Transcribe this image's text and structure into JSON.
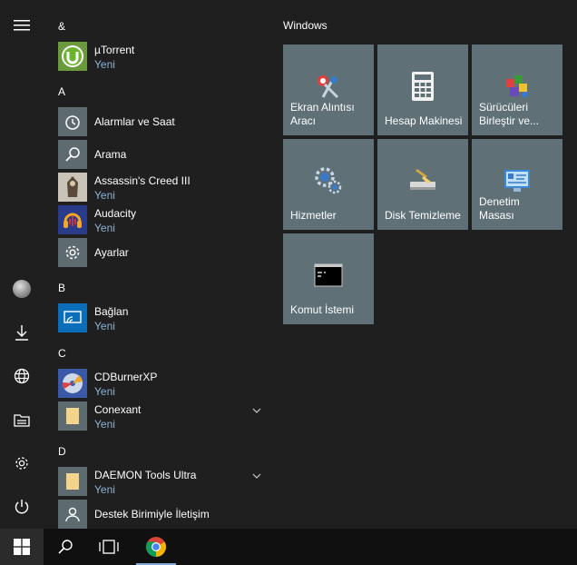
{
  "rail": {
    "items": [
      {
        "name": "menu",
        "icon": "hamburger-icon"
      },
      {
        "name": "user",
        "icon": "avatar"
      },
      {
        "name": "downloads",
        "icon": "download-icon"
      },
      {
        "name": "network",
        "icon": "globe-icon"
      },
      {
        "name": "file-explorer",
        "icon": "file-explorer-icon"
      },
      {
        "name": "settings",
        "icon": "gear-icon"
      },
      {
        "name": "power",
        "icon": "power-icon"
      }
    ]
  },
  "applist": {
    "letters": [
      "&",
      "A",
      "B",
      "C",
      "D"
    ],
    "apps": [
      {
        "name": "µTorrent",
        "sub": "Yeni"
      },
      {
        "name": "Alarmlar ve Saat",
        "sub": ""
      },
      {
        "name": "Arama",
        "sub": ""
      },
      {
        "name": "Assassin's Creed III",
        "sub": "Yeni"
      },
      {
        "name": "Audacity",
        "sub": "Yeni"
      },
      {
        "name": "Ayarlar",
        "sub": ""
      },
      {
        "name": "Bağlan",
        "sub": "Yeni"
      },
      {
        "name": "CDBurnerXP",
        "sub": "Yeni"
      },
      {
        "name": "Conexant",
        "sub": "Yeni"
      },
      {
        "name": "DAEMON Tools Ultra",
        "sub": "Yeni"
      },
      {
        "name": "Destek Birimiyle İletişim",
        "sub": ""
      }
    ]
  },
  "tiles": {
    "group_title": "Windows",
    "items": [
      {
        "label": "Ekran Alıntısı Aracı"
      },
      {
        "label": "Hesap Makinesi"
      },
      {
        "label": "Sürücüleri Birleştir ve..."
      },
      {
        "label": "Hizmetler"
      },
      {
        "label": "Disk Temizleme"
      },
      {
        "label": "Denetim Masası"
      },
      {
        "label": "Komut İstemi"
      }
    ]
  },
  "taskbar": {
    "items": [
      "start",
      "search",
      "task-view",
      "chrome"
    ]
  }
}
